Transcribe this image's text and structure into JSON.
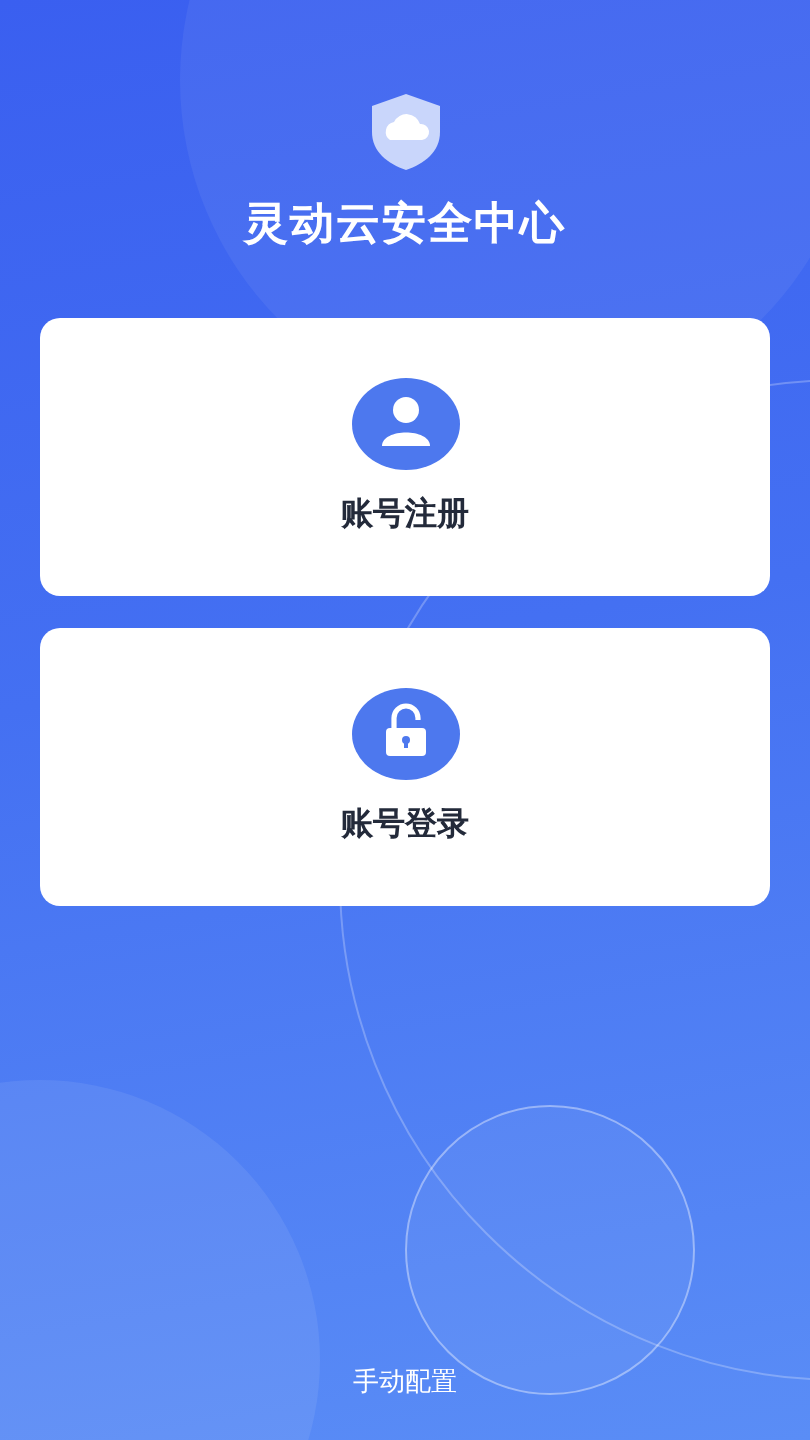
{
  "app": {
    "title": "灵动云安全中心"
  },
  "actions": [
    {
      "kind": "register",
      "label": "账号注册"
    },
    {
      "kind": "login",
      "label": "账号登录"
    }
  ],
  "footer": {
    "link": "手动配置"
  }
}
